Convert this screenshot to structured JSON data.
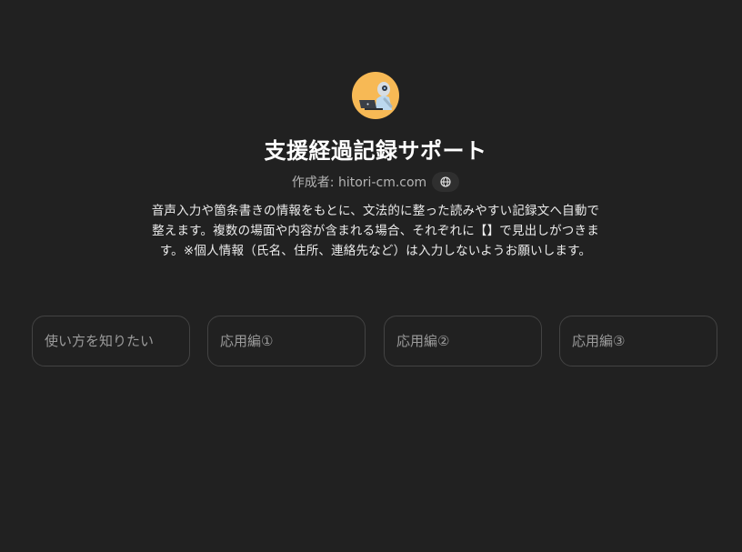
{
  "gpt": {
    "avatar_icon": "robot-with-laptop-icon",
    "title": "支援経過記録サポート",
    "author": "作成者: hitori-cm.com",
    "website_icon": "globe-icon",
    "description": "音声入力や箇条書きの情報をもとに、文法的に整った読みやすい記録文へ自動で整えます。複数の場面や内容が含まれる場合、それぞれに【】で見出しがつきます。※個人情報（氏名、住所、連絡先など）は入力しないようお願いします。"
  },
  "conversation_starters": [
    {
      "label": "使い方を知りたい"
    },
    {
      "label": "応用編①"
    },
    {
      "label": "応用編②"
    },
    {
      "label": "応用編③"
    }
  ],
  "colors": {
    "background": "#212121",
    "avatar_bg": "#f7b955",
    "starter_border": "#434343"
  }
}
